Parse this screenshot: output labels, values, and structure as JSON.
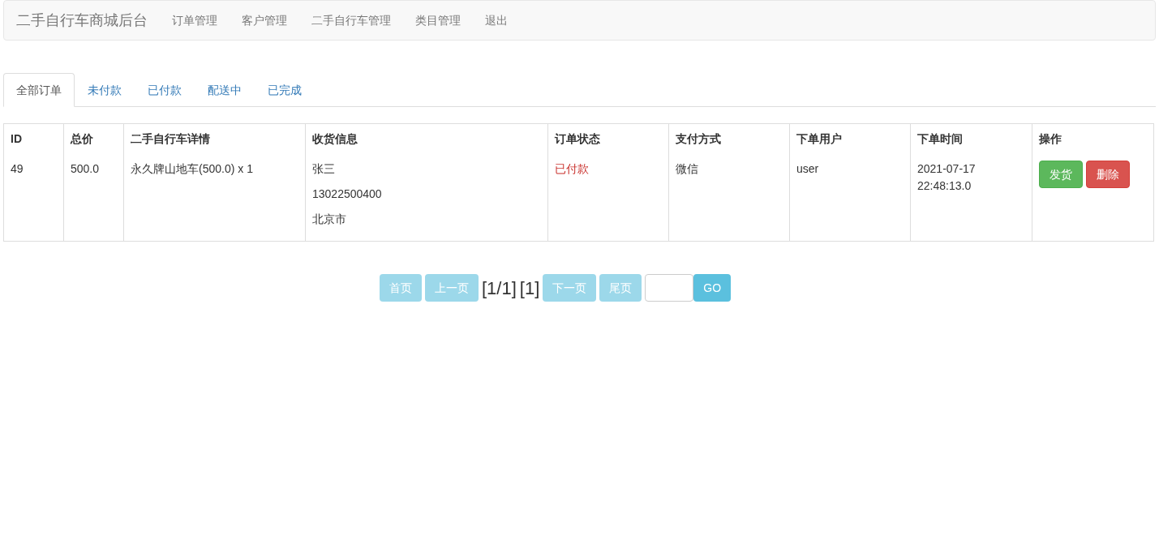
{
  "navbar": {
    "brand": "二手自行车商城后台",
    "items": [
      "订单管理",
      "客户管理",
      "二手自行车管理",
      "类目管理",
      "退出"
    ]
  },
  "tabs": [
    {
      "label": "全部订单",
      "selected": true
    },
    {
      "label": "未付款",
      "selected": false
    },
    {
      "label": "已付款",
      "selected": false
    },
    {
      "label": "配送中",
      "selected": false
    },
    {
      "label": "已完成",
      "selected": false
    }
  ],
  "table": {
    "columns": [
      "ID",
      "总价",
      "二手自行车详情",
      "收货信息",
      "订单状态",
      "支付方式",
      "下单用户",
      "下单时间",
      "操作"
    ],
    "rows": [
      {
        "id": "49",
        "total": "500.0",
        "detail": "永久牌山地车(500.0) x 1",
        "shipping": [
          "张三",
          "13022500400",
          "北京市"
        ],
        "status": "已付款",
        "payment": "微信",
        "user": "user",
        "time": [
          "2021-07-17",
          "22:48:13.0"
        ],
        "actions": [
          {
            "label": "发货",
            "kind": "success"
          },
          {
            "label": "删除",
            "kind": "danger"
          }
        ]
      }
    ]
  },
  "pagination": {
    "first": {
      "label": "首页",
      "disabled": true
    },
    "prev": {
      "label": "上一页",
      "disabled": true
    },
    "info": "[1/1]",
    "current": "[1]",
    "next": {
      "label": "下一页",
      "disabled": true
    },
    "last": {
      "label": "尾页",
      "disabled": true
    },
    "go": "GO"
  }
}
